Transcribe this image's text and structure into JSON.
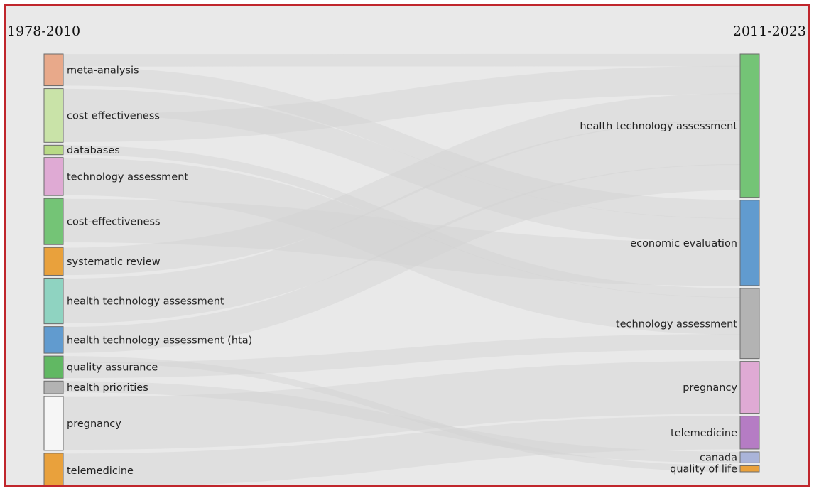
{
  "periods": {
    "left": "1978-2010",
    "right": "2011-2023"
  },
  "left_nodes": [
    {
      "label": "meta-analysis",
      "weight": 5,
      "color": "#e8a98a"
    },
    {
      "label": "cost effectiveness",
      "weight": 8.5,
      "color": "#c9e3a8"
    },
    {
      "label": "databases",
      "weight": 1.5,
      "color": "#b8da86"
    },
    {
      "label": "technology assessment",
      "weight": 6,
      "color": "#dfaad4"
    },
    {
      "label": "cost-effectiveness",
      "weight": 7.3,
      "color": "#74c476"
    },
    {
      "label": "systematic review",
      "weight": 4.4,
      "color": "#e9a13c"
    },
    {
      "label": "health technology assessment",
      "weight": 7.2,
      "color": "#8fd3c1"
    },
    {
      "label": "health technology assessment (hta)",
      "weight": 4.2,
      "color": "#619bcf"
    },
    {
      "label": "quality assurance",
      "weight": 3.5,
      "color": "#61b863"
    },
    {
      "label": "health priorities",
      "weight": 2,
      "color": "#b3b3b3"
    },
    {
      "label": "pregnancy",
      "weight": 8.5,
      "color": "#f6f6f6"
    },
    {
      "label": "telemedicine",
      "weight": 5.4,
      "color": "#e9a13c"
    }
  ],
  "right_nodes": [
    {
      "label": "health technology assessment",
      "weight": 23.5,
      "color": "#74c476"
    },
    {
      "label": "economic evaluation",
      "weight": 14,
      "color": "#619bcf"
    },
    {
      "label": "technology assessment",
      "weight": 11.5,
      "color": "#b3b3b3"
    },
    {
      "label": "pregnancy",
      "weight": 8.5,
      "color": "#dfaad4"
    },
    {
      "label": "telemedicine",
      "weight": 5.4,
      "color": "#b57cc4"
    },
    {
      "label": "canada",
      "weight": 1.8,
      "color": "#aab4d9"
    },
    {
      "label": "quality of life",
      "weight": 1,
      "color": "#e9a13c"
    }
  ],
  "flows": [
    {
      "source": 0,
      "target": 0,
      "value": 2
    },
    {
      "source": 0,
      "target": 1,
      "value": 3
    },
    {
      "source": 1,
      "target": 1,
      "value": 4
    },
    {
      "source": 1,
      "target": 0,
      "value": 4.5
    },
    {
      "source": 2,
      "target": 2,
      "value": 1.5
    },
    {
      "source": 3,
      "target": 2,
      "value": 6
    },
    {
      "source": 4,
      "target": 1,
      "value": 7
    },
    {
      "source": 5,
      "target": 0,
      "value": 4.4
    },
    {
      "source": 6,
      "target": 0,
      "value": 7.2
    },
    {
      "source": 7,
      "target": 0,
      "value": 4.2
    },
    {
      "source": 8,
      "target": 6,
      "value": 1
    },
    {
      "source": 8,
      "target": 2,
      "value": 2.5
    },
    {
      "source": 9,
      "target": 5,
      "value": 1.8
    },
    {
      "source": 10,
      "target": 3,
      "value": 8.5
    },
    {
      "source": 11,
      "target": 4,
      "value": 5.4
    }
  ]
}
